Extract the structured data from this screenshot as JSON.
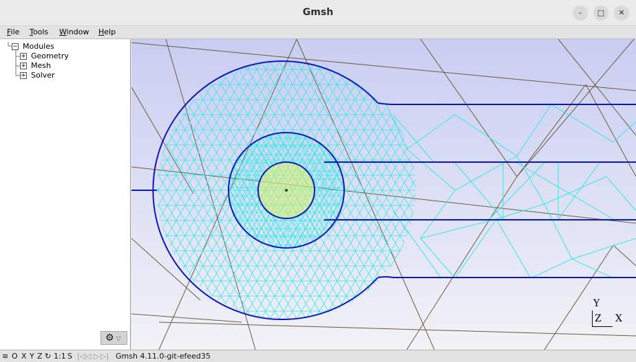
{
  "window": {
    "title": "Gmsh"
  },
  "menu": {
    "file": "File",
    "tools": "Tools",
    "window": "Window",
    "help": "Help"
  },
  "tree": {
    "root": {
      "label": "Modules",
      "expander": "−"
    },
    "items": [
      {
        "label": "Geometry",
        "expander": "+"
      },
      {
        "label": "Mesh",
        "expander": "+"
      },
      {
        "label": "Solver",
        "expander": "+"
      }
    ]
  },
  "axes": {
    "y": "Y",
    "z": "Z",
    "x": "X"
  },
  "status": {
    "hamburger": "≡",
    "o": "O",
    "x": "X",
    "y": "Y",
    "z": "Z",
    "rotate": "↻",
    "scale": "1:1",
    "s": "S",
    "nav_first": "|◁",
    "nav_prev": "◁",
    "nav_next": "▷",
    "nav_last": "▷|",
    "version": "Gmsh 4.11.0-git-efeed35"
  },
  "colors": {
    "geometry_lines": "#0d19b8",
    "mesh_edges": "#38e6e6",
    "background_mesh": "#6b5a3d",
    "selected_region": "#e8f06a",
    "viewport_top": "#c9cdf2",
    "viewport_bottom": "#f2f2f7"
  }
}
